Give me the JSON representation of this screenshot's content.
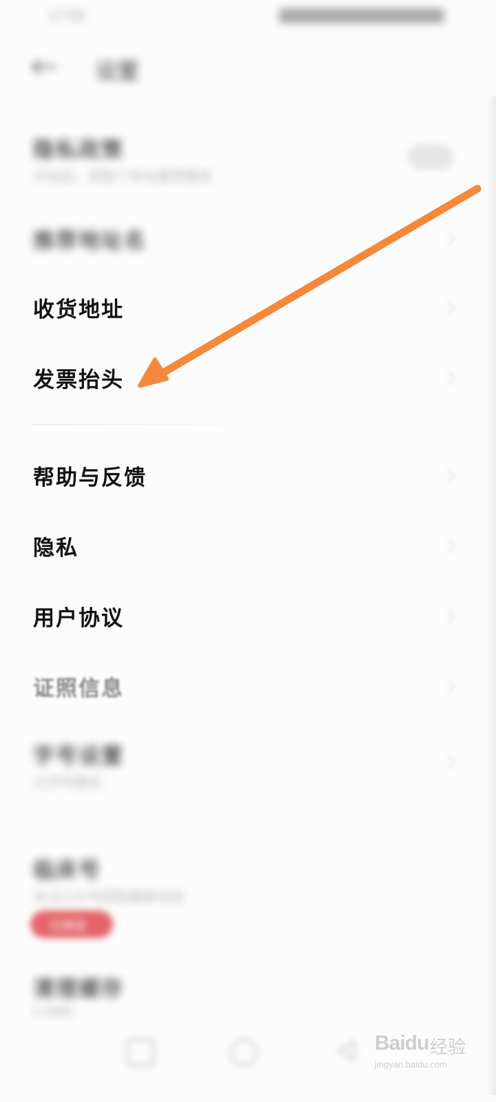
{
  "status_bar": {
    "time": "17:02"
  },
  "header": {
    "title": "设置",
    "back_icon": "back-arrow-icon"
  },
  "settings": {
    "top_items": [
      {
        "label": "隐私政策",
        "sub": "开启后，获取个性化推荐服务",
        "control": "toggle"
      },
      {
        "label": "推荐地址名"
      }
    ],
    "items_group1": [
      {
        "label": "收货地址"
      },
      {
        "label": "发票抬头"
      }
    ],
    "items_group2": [
      {
        "label": "帮助与反馈"
      },
      {
        "label": "隐私"
      },
      {
        "label": "用户协议"
      },
      {
        "label": "证照信息"
      }
    ],
    "bottom_items": [
      {
        "label": "字号设置",
        "sub": "大字号模式"
      },
      {
        "label": "临床号",
        "sub": "关注公众号获取最新动态",
        "badge": "已绑定"
      },
      {
        "label": "清理缓存",
        "sub": "0.0MB"
      }
    ]
  },
  "annotation": {
    "arrow_color": "#f5883a",
    "points_to": "发票抬头"
  },
  "watermark": {
    "brand": "Baidu",
    "brand_cn": "经验",
    "url": "jingyan.baidu.com"
  },
  "colors": {
    "background": "#fcfcfc",
    "text": "#111111",
    "accent_red": "#e04a50",
    "arrow": "#f5883a"
  }
}
